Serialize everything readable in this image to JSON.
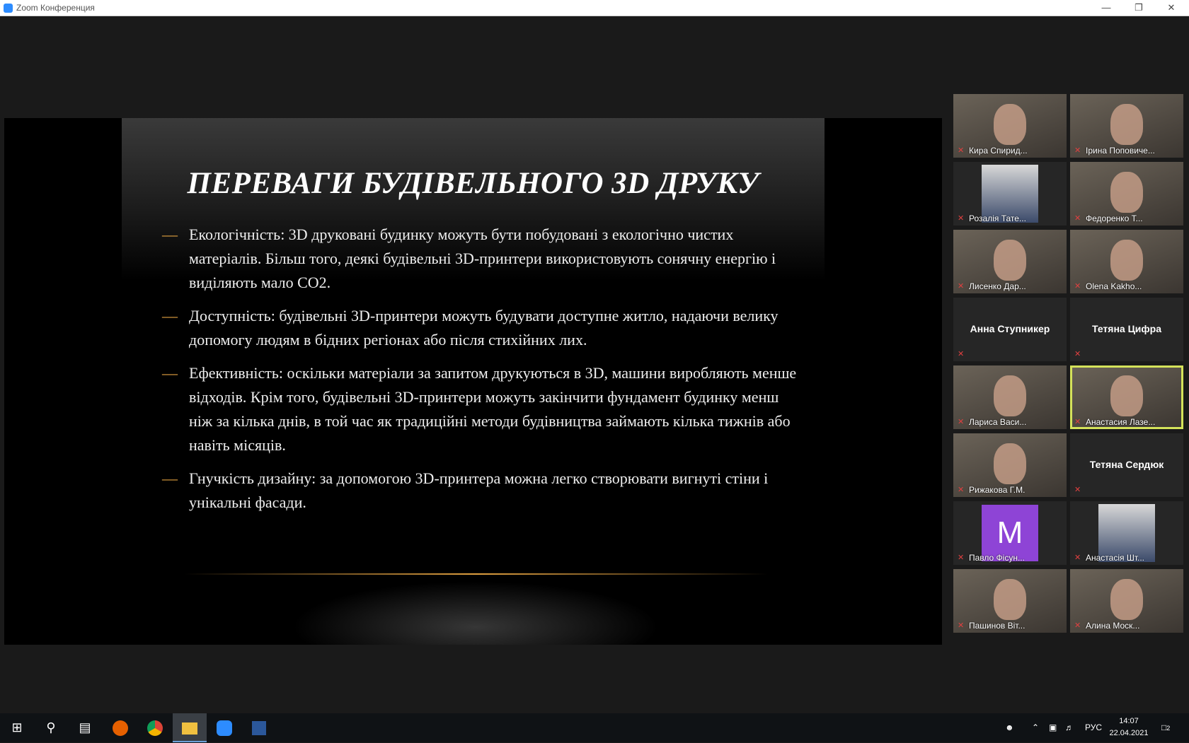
{
  "window": {
    "title": "Zoom Конференция"
  },
  "slide": {
    "title": "ПЕРЕВАГИ БУДІВЕЛЬНОГО 3D ДРУКУ",
    "bullets": [
      "Екологічність: 3D друковані будинку можуть бути побудовані з екологічно чистих матеріалів. Більш того, деякі будівельні 3D-принтери використовують сонячну енергію і виділяють мало CO2.",
      "Доступність: будівельні 3D-принтери можуть будувати доступне житло, надаючи велику допомогу людям в бідних регіонах або після стихійних лих.",
      "Ефективність: оскільки матеріали за запитом друкуються в 3D, машини виробляють менше відходів. Крім того, будівельні 3D-принтери можуть закінчити фундамент будинку менш ніж за кілька днів, в той час як традиційні методи будівництва займають кілька тижнів або навіть місяців.",
      "Гнучкість дизайну: за допомогою 3D-принтера можна легко створювати вигнуті стіни і унікальні фасади."
    ]
  },
  "participants": [
    {
      "name": "Кира Спирид...",
      "kind": "video"
    },
    {
      "name": "Ірина Поповиче...",
      "kind": "video"
    },
    {
      "name": "Розалія Тате...",
      "kind": "mini"
    },
    {
      "name": "Федоренко Т...",
      "kind": "video"
    },
    {
      "name": "Лисенко Дар...",
      "kind": "video"
    },
    {
      "name": "Olena Kakho...",
      "kind": "video"
    },
    {
      "name": "Анна Ступникер",
      "kind": "name"
    },
    {
      "name": "Тетяна Цифра",
      "kind": "name"
    },
    {
      "name": "Лариса Васи...",
      "kind": "video"
    },
    {
      "name": "Анастасия Лазе...",
      "kind": "video",
      "active": true
    },
    {
      "name": "Рижакова Г.М.",
      "kind": "video"
    },
    {
      "name": "Тетяна Сердюк",
      "kind": "name"
    },
    {
      "name": "Павло Фісун...",
      "kind": "letter",
      "letter": "M"
    },
    {
      "name": "Анастасія Шт...",
      "kind": "mini"
    },
    {
      "name": "Пашинов Віт...",
      "kind": "video"
    },
    {
      "name": "Алина Моск...",
      "kind": "video"
    }
  ],
  "taskbar": {
    "lang": "РУС",
    "time": "14:07",
    "date": "22.04.2021",
    "notifications": "2"
  }
}
